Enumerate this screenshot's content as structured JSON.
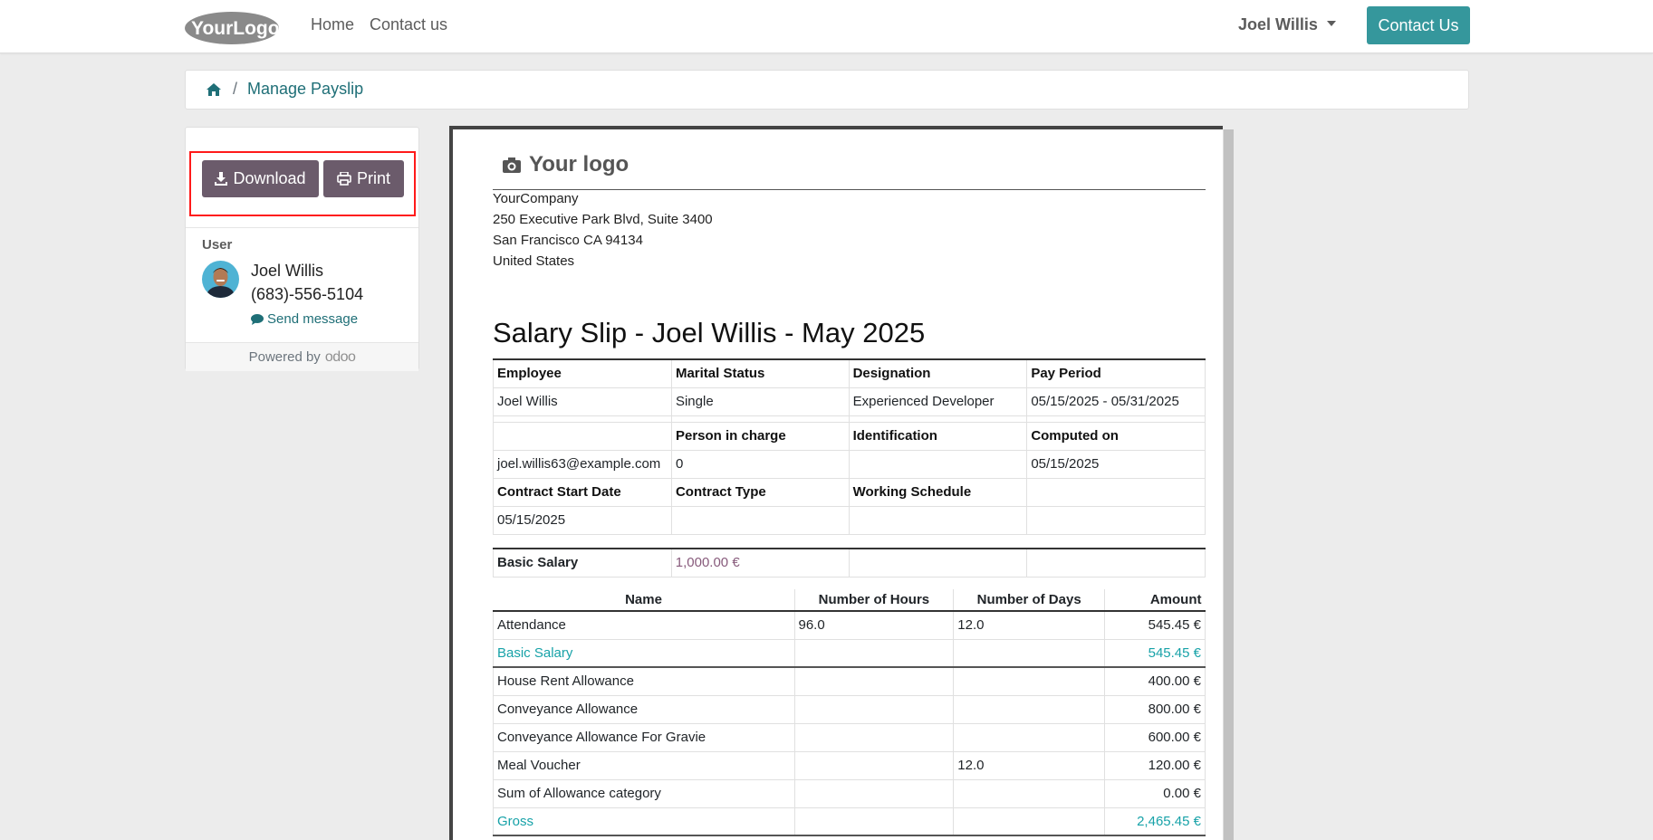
{
  "nav": {
    "logo_text": "YourLogo",
    "home": "Home",
    "contact": "Contact us",
    "user": "Joel Willis",
    "contact_button": "Contact Us"
  },
  "breadcrumb": {
    "current": "Manage Payslip"
  },
  "sidebar": {
    "download": "Download",
    "print": "Print",
    "user_label": "User",
    "user_name": "Joel Willis",
    "user_phone": "(683)-556-5104",
    "send_message": "Send message",
    "powered_by": "Powered by",
    "odoo": "odoo"
  },
  "document": {
    "logo_text": "Your logo",
    "company": "YourCompany",
    "address_line1": "250 Executive Park Blvd, Suite 3400",
    "address_line2": "San Francisco CA 94134",
    "country": "United States",
    "title": "Salary Slip - Joel Willis - May 2025",
    "info": {
      "h_employee": "Employee",
      "h_marital": "Marital Status",
      "h_designation": "Designation",
      "h_pay_period": "Pay Period",
      "employee": "Joel Willis",
      "marital": "Single",
      "designation": "Experienced Developer",
      "pay_period": "05/15/2025 - 05/31/2025",
      "h_person": "Person in charge",
      "h_identification": "Identification",
      "h_computed": "Computed on",
      "email": "joel.willis63@example.com",
      "person": "0",
      "computed": "05/15/2025",
      "h_contract_start": "Contract Start Date",
      "h_contract_type": "Contract Type",
      "h_schedule": "Working Schedule",
      "contract_start": "05/15/2025"
    },
    "basic_salary_label": "Basic Salary",
    "basic_salary_value": "1,000.00 €",
    "lines_headers": {
      "name": "Name",
      "hours": "Number of Hours",
      "days": "Number of Days",
      "amount": "Amount"
    },
    "lines": [
      {
        "name": "Attendance",
        "hours": "96.0",
        "days": "12.0",
        "amount": "545.45 €"
      },
      {
        "name": "Basic Salary",
        "hours": "",
        "days": "",
        "amount": "545.45 €"
      },
      {
        "name": "House Rent Allowance",
        "hours": "",
        "days": "",
        "amount": "400.00 €"
      },
      {
        "name": "Conveyance Allowance",
        "hours": "",
        "days": "",
        "amount": "800.00 €"
      },
      {
        "name": "Conveyance Allowance For Gravie",
        "hours": "",
        "days": "",
        "amount": "600.00 €"
      },
      {
        "name": "Meal Voucher",
        "hours": "",
        "days": "12.0",
        "amount": "120.00 €"
      },
      {
        "name": "Sum of Allowance category",
        "hours": "",
        "days": "",
        "amount": "0.00 €"
      },
      {
        "name": "Gross",
        "hours": "",
        "days": "",
        "amount": "2,465.45 €"
      }
    ]
  },
  "colors": {
    "accent": "#35979c",
    "button_dark": "#6b5b6b",
    "teal_text": "#17a2a8",
    "highlight": "#ff1a1a"
  }
}
